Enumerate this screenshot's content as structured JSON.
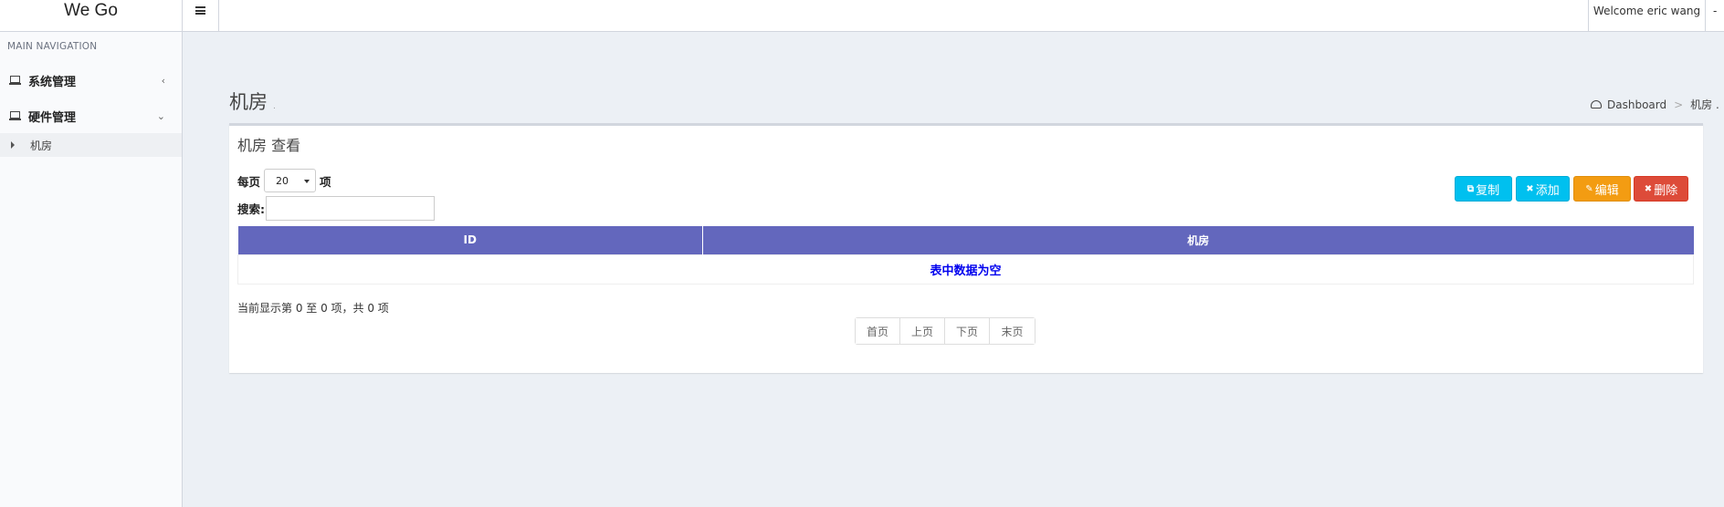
{
  "header": {
    "logo": "We Go",
    "welcome": "Welcome eric wang",
    "extra": "-"
  },
  "sidebar": {
    "header": "MAIN NAVIGATION",
    "items": [
      {
        "label": "系统管理",
        "chevron": "‹",
        "icon": "laptop-icon"
      },
      {
        "label": "硬件管理",
        "chevron": "⌄",
        "icon": "laptop-icon"
      }
    ],
    "sub_items": [
      {
        "label": "机房",
        "icon": "caret-right-icon"
      }
    ]
  },
  "content": {
    "title": "机房",
    "subtitle": ".",
    "breadcrumb": {
      "home": "Dashboard",
      "sep": ">",
      "current": "机房 ."
    }
  },
  "box": {
    "title": "机房 查看",
    "length_prefix": "每页",
    "length_value": "20",
    "length_suffix": "项",
    "search_label": "搜索:",
    "search_value": "",
    "buttons": {
      "copy": "复制",
      "add": "添加",
      "edit": "编辑",
      "delete": "删除"
    },
    "table": {
      "columns": [
        "ID",
        "机房"
      ],
      "empty_text": "表中数据为空"
    },
    "info": "当前显示第 0 至 0 项，共 0 项",
    "pager": [
      "首页",
      "上页",
      "下页",
      "末页"
    ]
  },
  "colors": {
    "table_header": "#6367bd",
    "btn_info": "#00c0ef",
    "btn_warning": "#f39c12",
    "btn_danger": "#dd4b39",
    "empty_text": "#0000ee"
  }
}
